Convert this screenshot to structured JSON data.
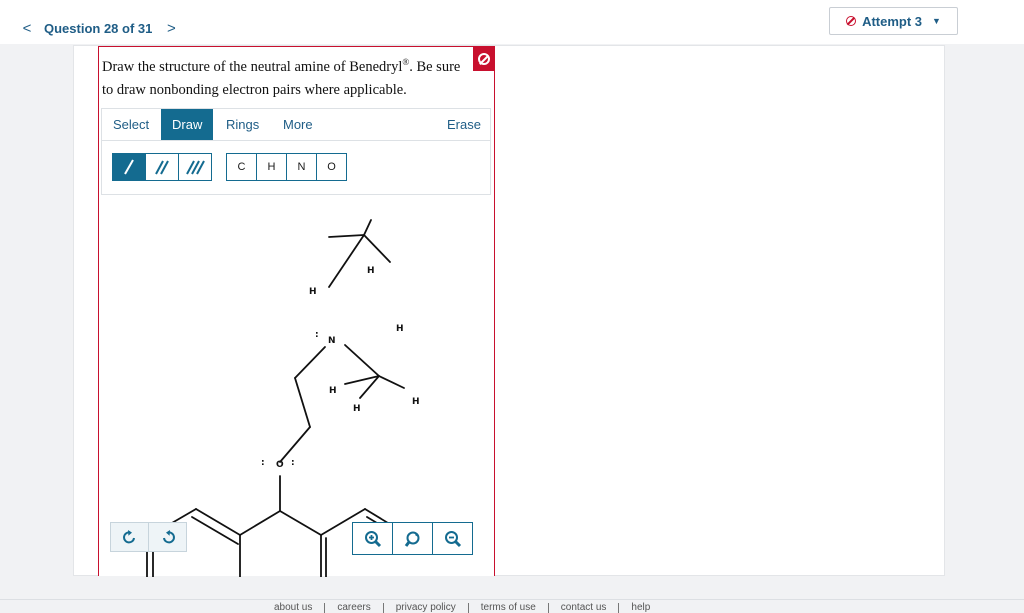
{
  "nav": {
    "prev": "<",
    "title": "Question 28 of 31",
    "next": ">"
  },
  "attempt": {
    "label": "Attempt 3",
    "caret": "▼"
  },
  "question": {
    "text_before": "Draw the structure of the neutral amine of Benedryl",
    "registered": "®",
    "text_after": ". Be sure to draw nonbonding electron pairs where applicable."
  },
  "tabs": {
    "select": "Select",
    "draw": "Draw",
    "rings": "Rings",
    "more": "More",
    "erase": "Erase"
  },
  "atoms": [
    "C",
    "H",
    "N",
    "O"
  ],
  "molecule": {
    "labels": {
      "h": "H",
      "n": "N",
      "o": "O",
      "n_lone_pair": ":",
      "o_lone_left": ":",
      "o_lone_right": ":"
    }
  },
  "footer": [
    "about us",
    "careers",
    "privacy policy",
    "terms of use",
    "contact us",
    "help"
  ],
  "colors": {
    "accent": "#146b90",
    "link": "#1f5d86",
    "alert": "#c8102e"
  }
}
